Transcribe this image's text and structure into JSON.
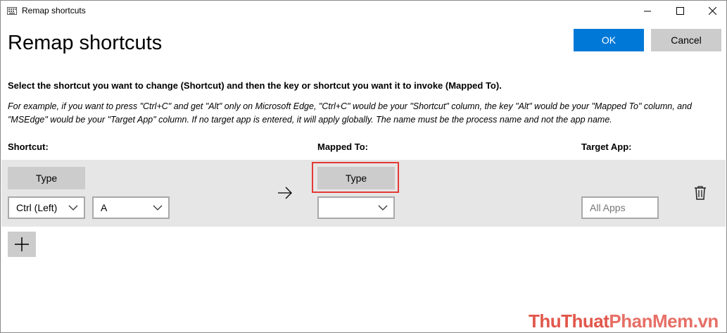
{
  "window": {
    "title": "Remap shortcuts"
  },
  "header": {
    "title": "Remap shortcuts",
    "ok_label": "OK",
    "cancel_label": "Cancel"
  },
  "instructions": {
    "main": "Select the shortcut you want to change (Shortcut) and then the key or shortcut you want it to invoke (Mapped To).",
    "example": "For example, if you want to press \"Ctrl+C\" and get \"Alt\" only on Microsoft Edge, \"Ctrl+C\" would be your \"Shortcut\" column, the key \"Alt\" would be your \"Mapped To\" column, and \"MSEdge\" would be your \"Target App\" column. If no target app is entered, it will apply globally. The name must be the process name and not the app name."
  },
  "columns": {
    "shortcut": "Shortcut:",
    "mapped_to": "Mapped To:",
    "target_app": "Target App:"
  },
  "row": {
    "shortcut_type_label": "Type",
    "modifier_value": "Ctrl (Left)",
    "key_value": "A",
    "mapped_type_label": "Type",
    "mapped_value": "",
    "target_placeholder": "All Apps"
  },
  "icons": {
    "app": "keyboard-icon",
    "arrow": "arrow-right-icon",
    "delete": "trash-icon",
    "add": "plus-icon",
    "chevron": "chevron-down-icon"
  },
  "colors": {
    "accent": "#0078d7",
    "highlight": "#e53935",
    "row_bg": "#e6e6e6",
    "button_gray": "#cccccc"
  },
  "watermark": {
    "text_1": "ThuThuat",
    "text_2": "PhanMem",
    "text_3": ".vn"
  }
}
